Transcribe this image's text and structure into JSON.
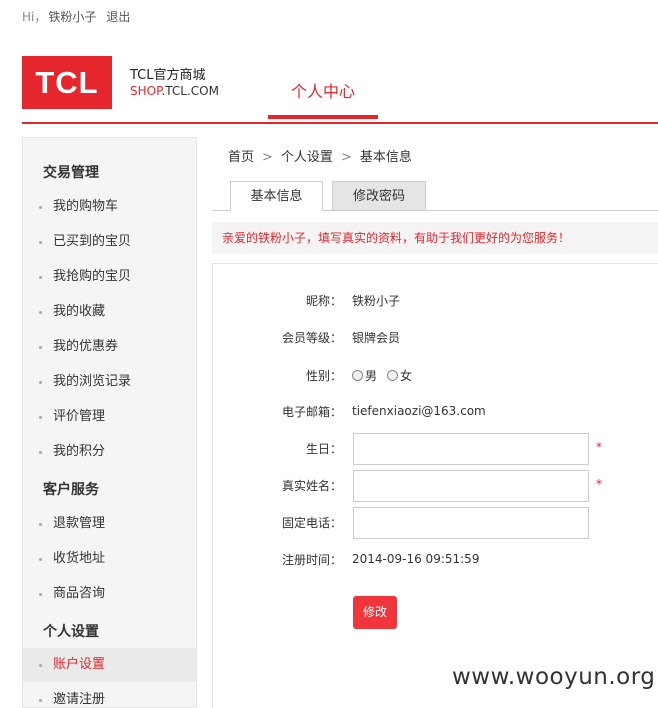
{
  "topbar": {
    "hi": "Hi，",
    "username": "铁粉小子",
    "logout": "退出"
  },
  "brand": {
    "logo_text": "TCL",
    "name": "TCL官方商城",
    "url_prefix": "SHOP",
    "url_suffix": ".TCL.COM"
  },
  "nav": {
    "current": "个人中心"
  },
  "sidebar": {
    "groups": [
      "交易管理",
      "客户服务",
      "个人设置"
    ],
    "items": [
      "我的购物车",
      "已买到的宝贝",
      "我抢购的宝贝",
      "我的收藏",
      "我的优惠券",
      "我的浏览记录",
      "评价管理",
      "我的积分",
      "退款管理",
      "收货地址",
      "商品咨询",
      "账户设置",
      "邀请注册"
    ]
  },
  "breadcrumb": {
    "home": "首页",
    "sep": ">",
    "level1": "个人设置",
    "level2": "基本信息"
  },
  "tabs": [
    "基本信息",
    "修改密码"
  ],
  "notice": "亲爱的铁粉小子，填写真实的资料，有助于我们更好的为您服务！",
  "form": {
    "nickname_label": "昵称：",
    "nickname": "铁粉小子",
    "level_label": "会员等级：",
    "level": "银牌会员",
    "gender_label": "性别：",
    "gender_male": "男",
    "gender_female": "女",
    "email_label": "电子邮箱：",
    "email": "tiefenxiaozi@163.com",
    "birthday_label": "生日：",
    "birthday": "",
    "realname_label": "真实姓名：",
    "realname": "",
    "phone_label": "固定电话：",
    "phone": "",
    "regtime_label": "注册时间：",
    "regtime": "2014-09-16 09:51:59",
    "required_mark": "*",
    "submit": "修改"
  },
  "watermark": "www.wooyun.org",
  "colors": {
    "accent": "#e5262d",
    "button": "#f0353c"
  }
}
